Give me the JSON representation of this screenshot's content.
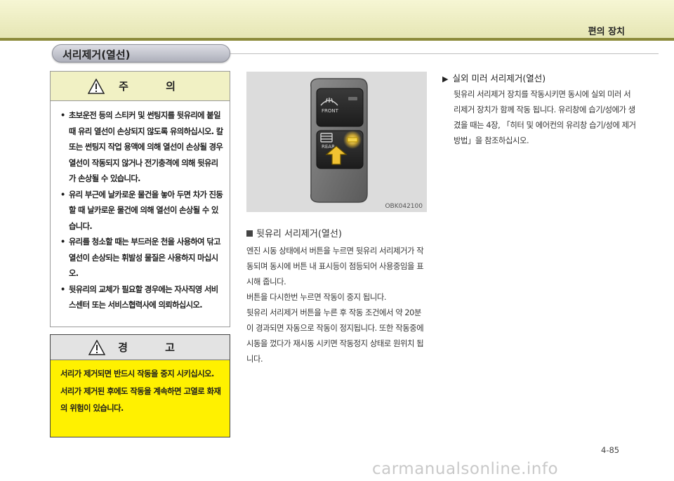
{
  "header": {
    "title": "편의 장치"
  },
  "section": {
    "title": "서리제거(열선)"
  },
  "caution": {
    "title": "주 의",
    "items": [
      "초보운전 등의 스티커 및 썬팅지를 뒷유리에 붙일 때 유리 열선이 손상되지 않도록 유의하십시오. 칼 또는 썬팅지 작업 용액에 의해 열선이 손상될 경우 열선이 작동되지 않거나 전기충격에 의해 뒷유리가 손상될 수 있습니다.",
      "유리 부근에 날카로운 물건을 놓아 두면 차가 진동할 때 날카로운 물건에 의해 열선이 손상될 수 있습니다.",
      "유리를 청소할 때는 부드러운 천을 사용하여 닦고 열선이 손상되는 휘발성 물질은 사용하지 마십시오.",
      "뒷유리의 교체가 필요할 경우에는 자사직영 서비스센터 또는 서비스협력사에 의뢰하십시오."
    ]
  },
  "warning": {
    "title": "경 고",
    "lines": [
      "서리가 제거되면 반드시 작동을 중지 시키십시오.",
      "서리가 제거된 후에도 작동을 계속하면 고열로 화재의 위험이 있습니다."
    ]
  },
  "figure": {
    "code": "OBK042100",
    "front_label": "FRONT",
    "rear_label": "REAR"
  },
  "rear_defroster": {
    "heading": "뒷유리 서리제거(열선)",
    "paragraphs": [
      "엔진 시동 상태에서 버튼을 누르면 뒷유리 서리제거가 작동되며 동시에 버튼 내 표시등이 점등되어 사용중임을 표시해 줍니다.",
      "버튼을 다시한번 누르면 작동이 중지 됩니다.",
      "뒷유리 서리제거 버튼을 누른 후 작동 조건에서 약 20분이 경과되면 자동으로 작동이 정지됩니다. 또한 작동중에 시동을 껐다가 재시동 시키면 작동정지 상태로 원위치 됩니다."
    ]
  },
  "mirror_defroster": {
    "heading": "실외 미러 서리제거(열선)",
    "body": "뒷유리 서리제거 장치를 작동시키면 동시에 실외 미러 서리제거 장치가 함께 작동 됩니다. 유리창에 습기/성에가 생겼을 때는 4장, 「히터 및 에어컨의 유리창 습기/성에 제거 방법」을 참조하십시오."
  },
  "page": {
    "number": "4-85"
  },
  "watermark": {
    "text": "carmanualsonline.info"
  }
}
